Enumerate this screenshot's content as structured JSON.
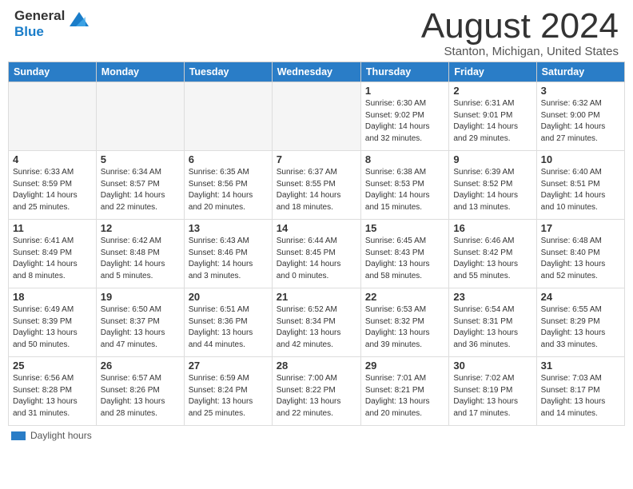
{
  "header": {
    "title": "August 2024",
    "location": "Stanton, Michigan, United States",
    "logo_general": "General",
    "logo_blue": "Blue"
  },
  "days_of_week": [
    "Sunday",
    "Monday",
    "Tuesday",
    "Wednesday",
    "Thursday",
    "Friday",
    "Saturday"
  ],
  "weeks": [
    [
      {
        "num": "",
        "info": ""
      },
      {
        "num": "",
        "info": ""
      },
      {
        "num": "",
        "info": ""
      },
      {
        "num": "",
        "info": ""
      },
      {
        "num": "1",
        "info": "Sunrise: 6:30 AM\nSunset: 9:02 PM\nDaylight: 14 hours\nand 32 minutes."
      },
      {
        "num": "2",
        "info": "Sunrise: 6:31 AM\nSunset: 9:01 PM\nDaylight: 14 hours\nand 29 minutes."
      },
      {
        "num": "3",
        "info": "Sunrise: 6:32 AM\nSunset: 9:00 PM\nDaylight: 14 hours\nand 27 minutes."
      }
    ],
    [
      {
        "num": "4",
        "info": "Sunrise: 6:33 AM\nSunset: 8:59 PM\nDaylight: 14 hours\nand 25 minutes."
      },
      {
        "num": "5",
        "info": "Sunrise: 6:34 AM\nSunset: 8:57 PM\nDaylight: 14 hours\nand 22 minutes."
      },
      {
        "num": "6",
        "info": "Sunrise: 6:35 AM\nSunset: 8:56 PM\nDaylight: 14 hours\nand 20 minutes."
      },
      {
        "num": "7",
        "info": "Sunrise: 6:37 AM\nSunset: 8:55 PM\nDaylight: 14 hours\nand 18 minutes."
      },
      {
        "num": "8",
        "info": "Sunrise: 6:38 AM\nSunset: 8:53 PM\nDaylight: 14 hours\nand 15 minutes."
      },
      {
        "num": "9",
        "info": "Sunrise: 6:39 AM\nSunset: 8:52 PM\nDaylight: 14 hours\nand 13 minutes."
      },
      {
        "num": "10",
        "info": "Sunrise: 6:40 AM\nSunset: 8:51 PM\nDaylight: 14 hours\nand 10 minutes."
      }
    ],
    [
      {
        "num": "11",
        "info": "Sunrise: 6:41 AM\nSunset: 8:49 PM\nDaylight: 14 hours\nand 8 minutes."
      },
      {
        "num": "12",
        "info": "Sunrise: 6:42 AM\nSunset: 8:48 PM\nDaylight: 14 hours\nand 5 minutes."
      },
      {
        "num": "13",
        "info": "Sunrise: 6:43 AM\nSunset: 8:46 PM\nDaylight: 14 hours\nand 3 minutes."
      },
      {
        "num": "14",
        "info": "Sunrise: 6:44 AM\nSunset: 8:45 PM\nDaylight: 14 hours\nand 0 minutes."
      },
      {
        "num": "15",
        "info": "Sunrise: 6:45 AM\nSunset: 8:43 PM\nDaylight: 13 hours\nand 58 minutes."
      },
      {
        "num": "16",
        "info": "Sunrise: 6:46 AM\nSunset: 8:42 PM\nDaylight: 13 hours\nand 55 minutes."
      },
      {
        "num": "17",
        "info": "Sunrise: 6:48 AM\nSunset: 8:40 PM\nDaylight: 13 hours\nand 52 minutes."
      }
    ],
    [
      {
        "num": "18",
        "info": "Sunrise: 6:49 AM\nSunset: 8:39 PM\nDaylight: 13 hours\nand 50 minutes."
      },
      {
        "num": "19",
        "info": "Sunrise: 6:50 AM\nSunset: 8:37 PM\nDaylight: 13 hours\nand 47 minutes."
      },
      {
        "num": "20",
        "info": "Sunrise: 6:51 AM\nSunset: 8:36 PM\nDaylight: 13 hours\nand 44 minutes."
      },
      {
        "num": "21",
        "info": "Sunrise: 6:52 AM\nSunset: 8:34 PM\nDaylight: 13 hours\nand 42 minutes."
      },
      {
        "num": "22",
        "info": "Sunrise: 6:53 AM\nSunset: 8:32 PM\nDaylight: 13 hours\nand 39 minutes."
      },
      {
        "num": "23",
        "info": "Sunrise: 6:54 AM\nSunset: 8:31 PM\nDaylight: 13 hours\nand 36 minutes."
      },
      {
        "num": "24",
        "info": "Sunrise: 6:55 AM\nSunset: 8:29 PM\nDaylight: 13 hours\nand 33 minutes."
      }
    ],
    [
      {
        "num": "25",
        "info": "Sunrise: 6:56 AM\nSunset: 8:28 PM\nDaylight: 13 hours\nand 31 minutes."
      },
      {
        "num": "26",
        "info": "Sunrise: 6:57 AM\nSunset: 8:26 PM\nDaylight: 13 hours\nand 28 minutes."
      },
      {
        "num": "27",
        "info": "Sunrise: 6:59 AM\nSunset: 8:24 PM\nDaylight: 13 hours\nand 25 minutes."
      },
      {
        "num": "28",
        "info": "Sunrise: 7:00 AM\nSunset: 8:22 PM\nDaylight: 13 hours\nand 22 minutes."
      },
      {
        "num": "29",
        "info": "Sunrise: 7:01 AM\nSunset: 8:21 PM\nDaylight: 13 hours\nand 20 minutes."
      },
      {
        "num": "30",
        "info": "Sunrise: 7:02 AM\nSunset: 8:19 PM\nDaylight: 13 hours\nand 17 minutes."
      },
      {
        "num": "31",
        "info": "Sunrise: 7:03 AM\nSunset: 8:17 PM\nDaylight: 13 hours\nand 14 minutes."
      }
    ]
  ],
  "legend": {
    "label": "Daylight hours"
  }
}
